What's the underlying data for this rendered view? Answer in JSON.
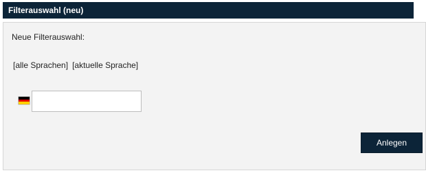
{
  "window": {
    "title": "Filterauswahl (neu)"
  },
  "form": {
    "label": "Neue Filterauswahl:",
    "lang_all": "[alle Sprachen]",
    "lang_current": "[aktuelle Sprache]",
    "flag_icon": "germany-flag-icon",
    "input_value": "",
    "input_placeholder": ""
  },
  "actions": {
    "create_label": "Anlegen"
  },
  "colors": {
    "header_bg": "#0c2438",
    "panel_bg": "#f3f3f3",
    "button_bg": "#0c2438",
    "flag_black": "#000000",
    "flag_red": "#dd0000",
    "flag_gold": "#ffce00"
  }
}
